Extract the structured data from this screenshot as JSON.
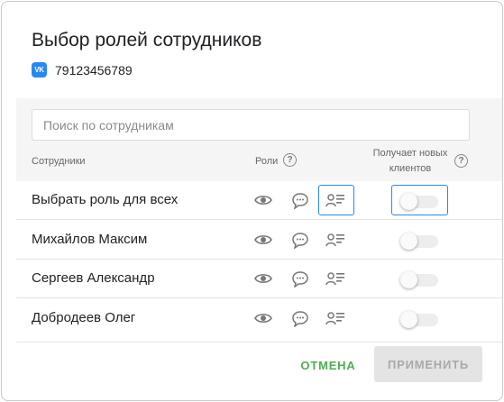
{
  "dialog": {
    "title": "Выбор ролей сотрудников",
    "vk_icon_label": "VK",
    "phone": "79123456789"
  },
  "search": {
    "placeholder": "Поиск по сотрудникам",
    "value": ""
  },
  "columns": {
    "employees": "Сотрудники",
    "roles": "Роли",
    "receives_new_clients_line1": "Получает новых",
    "receives_new_clients_line2": "клиентов",
    "help_glyph": "?"
  },
  "rows": [
    {
      "name": "Выбрать роль для всех",
      "receives_new_clients": false
    },
    {
      "name": "Михайлов Максим",
      "receives_new_clients": false
    },
    {
      "name": "Сергеев Александр",
      "receives_new_clients": false
    },
    {
      "name": "Добродеев Олег",
      "receives_new_clients": false
    }
  ],
  "buttons": {
    "cancel": "ОТМЕНА",
    "apply": "ПРИМЕНИТЬ"
  },
  "colors": {
    "accent": "#2787f5",
    "cancel": "#4caf50",
    "apply_disabled_bg": "#e4e4e4",
    "header_bg": "#f5f5f5"
  },
  "icons": {
    "role_view": "eye-icon",
    "role_chat": "chat-icon",
    "role_manager": "contact-card-icon"
  }
}
